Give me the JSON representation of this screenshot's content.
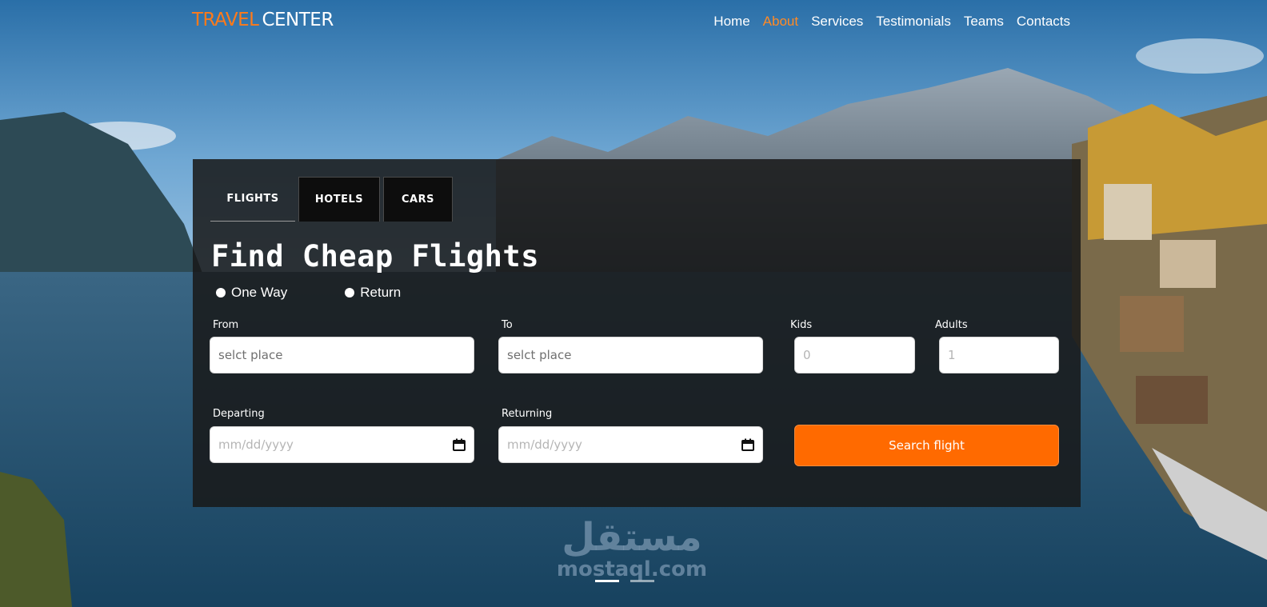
{
  "brand": {
    "part1": "TRAVEL",
    "part2": "CENTER"
  },
  "nav": {
    "items": [
      "Home",
      "About",
      "Services",
      "Testimonials",
      "Teams",
      "Contacts"
    ],
    "active": "About"
  },
  "booking": {
    "tabs": [
      "FLIGHTS",
      "HOTELS",
      "CARS"
    ],
    "active_tab": "FLIGHTS",
    "heading": "Find Cheap Flights",
    "trip_types": [
      "One Way",
      "Return"
    ],
    "fields": {
      "from": {
        "label": "From",
        "placeholder": "selct place"
      },
      "to": {
        "label": "To",
        "placeholder": "selct place"
      },
      "kids": {
        "label": "Kids",
        "placeholder": "0"
      },
      "adults": {
        "label": "Adults",
        "placeholder": "1"
      },
      "departing": {
        "label": "Departing",
        "placeholder": "mm/dd/yyyy"
      },
      "returning": {
        "label": "Returning",
        "placeholder": "mm/dd/yyyy"
      }
    },
    "search_button": "Search flight"
  },
  "watermark": {
    "arabic": "مستقل",
    "latin": "mostaql.com"
  },
  "colors": {
    "accent": "#ff6a00",
    "brand_orange": "#ff7a1a",
    "panel_bg": "#181818"
  }
}
